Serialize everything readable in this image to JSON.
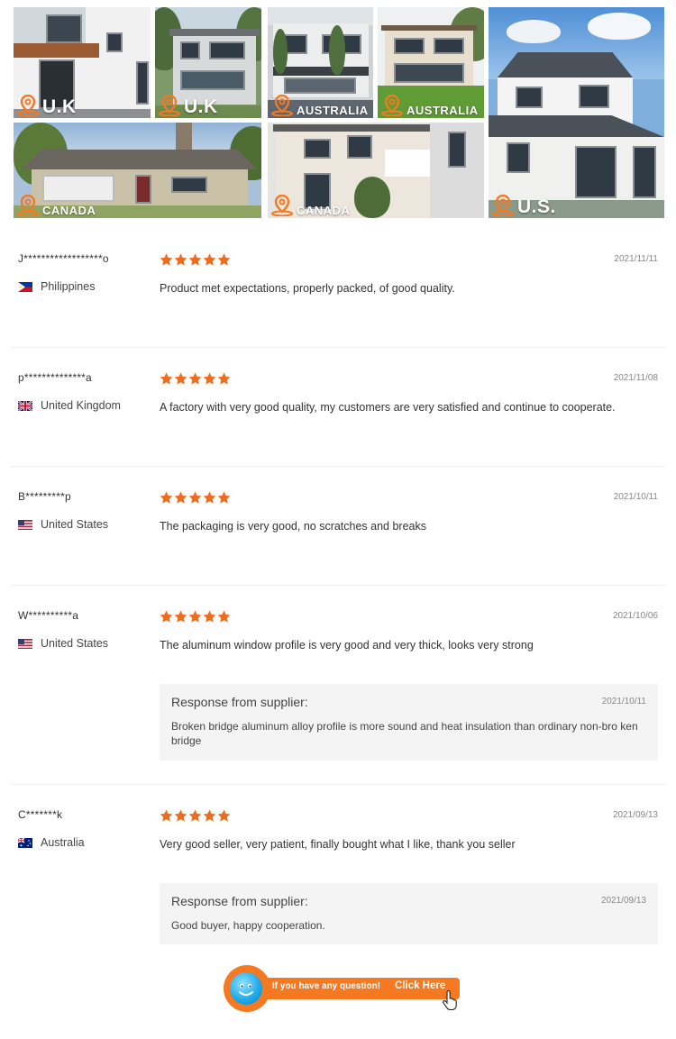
{
  "gallery": [
    {
      "location": "U.K"
    },
    {
      "location": "U.K"
    },
    {
      "location": "AUSTRALIA"
    },
    {
      "location": "AUSTRALIA"
    },
    {
      "location": "U.S."
    },
    {
      "location": "CANADA"
    },
    {
      "location": "CANADA"
    }
  ],
  "reviews": [
    {
      "reviewer": "J******************o",
      "country": "Philippines",
      "flag": "philippines-flag-icon",
      "rating": 5,
      "date": "2021/11/11",
      "comment": "Product met expectations, properly packed, of good quality."
    },
    {
      "reviewer": "p**************a",
      "country": "United Kingdom",
      "flag": "uk-flag-icon",
      "rating": 5,
      "date": "2021/11/08",
      "comment": "A factory with very good quality, my customers are very satisfied and continue to cooperate."
    },
    {
      "reviewer": "B*********p",
      "country": "United States",
      "flag": "us-flag-icon",
      "rating": 5,
      "date": "2021/10/11",
      "comment": "The packaging is very good, no scratches and breaks"
    },
    {
      "reviewer": "W**********a",
      "country": "United States",
      "flag": "us-flag-icon",
      "rating": 5,
      "date": "2021/10/06",
      "comment": "The aluminum window profile is very good and very thick, looks very strong",
      "response": {
        "title": "Response from supplier:",
        "date": "2021/10/11",
        "text": "Broken bridge aluminum alloy profile is more sound and heat insulation than ordinary non-bro ken bridge"
      }
    },
    {
      "reviewer": "C*******k",
      "country": "Australia",
      "flag": "australia-flag-icon",
      "rating": 5,
      "date": "2021/09/13",
      "comment": "Very good seller, very patient, finally bought what I like, thank you seller",
      "response": {
        "title": "Response from supplier:",
        "date": "2021/09/13",
        "text": "Good buyer, happy cooperation."
      }
    }
  ],
  "question_banner": {
    "text": "If you have any question!",
    "action": "Click Here"
  },
  "colors": {
    "accent": "#f47920",
    "star": "#f26b1d",
    "response_bg": "#f4f4f4"
  }
}
